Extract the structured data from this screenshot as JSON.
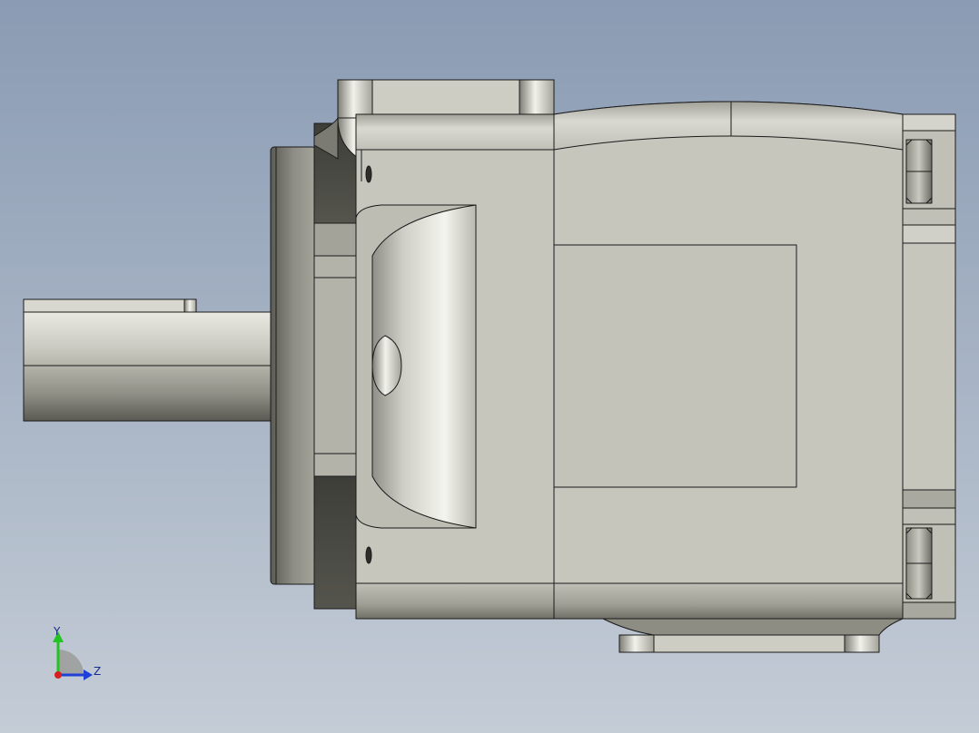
{
  "viewport": {
    "background_top": "#8a9bb3",
    "background_bottom": "#c4ccd6"
  },
  "model": {
    "body_color": "#c6c6bd",
    "edge_color": "#1a1a1a"
  },
  "triad": {
    "y_label": "Y",
    "z_label": "Z",
    "y_color": "#22c322",
    "z_color": "#1f3fd6",
    "x_color": "#d61f1f"
  }
}
